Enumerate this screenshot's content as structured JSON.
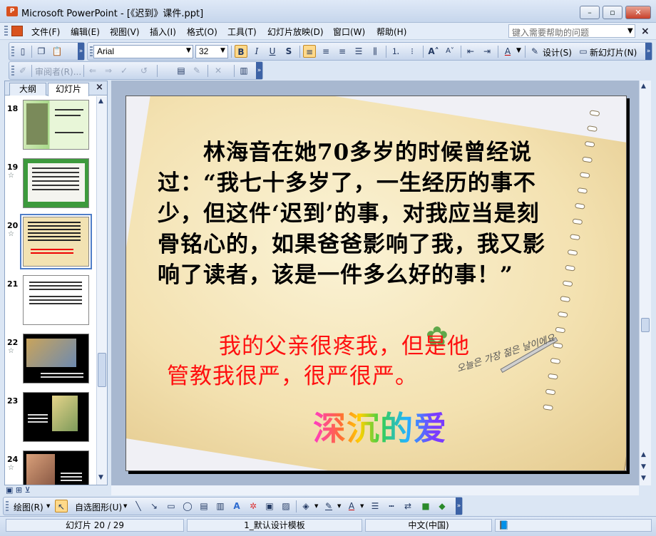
{
  "window": {
    "title": "Microsoft PowerPoint - [《迟到》课件.ppt]",
    "minimize": "–",
    "maximize": "▫",
    "close": "✕"
  },
  "menu": {
    "items": [
      "文件(F)",
      "编辑(E)",
      "视图(V)",
      "插入(I)",
      "格式(O)",
      "工具(T)",
      "幻灯片放映(D)",
      "窗口(W)",
      "帮助(H)"
    ],
    "help_placeholder": "键入需要帮助的问题"
  },
  "format_toolbar": {
    "font_name": "Arial",
    "font_size": "32",
    "bold": "B",
    "italic": "I",
    "underline": "U",
    "shadow": "S",
    "design_label": "设计(S)",
    "new_slide_label": "新幻灯片(N)"
  },
  "review_toolbar": {
    "reviewer_label": "审阅者(R)..."
  },
  "outline_panel": {
    "tab_outline": "大纲",
    "tab_slides": "幻灯片",
    "close": "×",
    "slide_numbers": [
      "18",
      "19",
      "20",
      "21",
      "22",
      "23",
      "24"
    ],
    "selected_slide": "20"
  },
  "slide": {
    "body_text": "林海音在她70多岁的时候曾经说过：“我七十多岁了，一生经历的事不少，但这件‘迟到’的事，对我应当是刻骨铭心的，如果爸爸影响了我，我又影响了读者，该是一件多么好的事！”",
    "red_line1": "我的父亲很疼我，但是他",
    "red_line2": "管教我很严，很严很严。",
    "wordart": "深沉的爱",
    "script_text": "오늘은 가장 젊은 날이에요"
  },
  "drawing_toolbar": {
    "draw_label": "绘图(R)",
    "autoshapes_label": "自选图形(U)"
  },
  "status": {
    "slide_pos": "幻灯片 20 / 29",
    "template": "1_默认设计模板",
    "language": "中文(中国)"
  },
  "colors": {
    "accent": "#3d63a6",
    "red_text": "#ff1010",
    "selection": "#4f7ec8"
  }
}
